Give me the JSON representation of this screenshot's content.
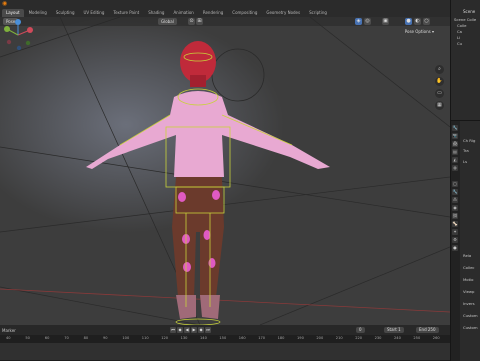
{
  "app": {
    "logo": "blender-logo"
  },
  "workspaces": [
    "Layout",
    "Modeling",
    "Sculpting",
    "UV Editing",
    "Texture Paint",
    "Shading",
    "Animation",
    "Rendering",
    "Compositing",
    "Geometry Nodes",
    "Scripting"
  ],
  "viewport": {
    "mode": "Pose",
    "transform_orientation": "Global",
    "pose_options": "Pose Options ▾",
    "gizmo_axes": {
      "x": "X",
      "y": "Y",
      "z": "Z"
    }
  },
  "timeline": {
    "label": "Marker",
    "frame_current": "0",
    "start_label": "Start",
    "start": "1",
    "end_label": "End",
    "end": "250",
    "ruler": [
      "40",
      "50",
      "60",
      "70",
      "80",
      "90",
      "100",
      "110",
      "120",
      "130",
      "140",
      "150",
      "160",
      "170",
      "180",
      "190",
      "200",
      "210",
      "220",
      "230",
      "240",
      "250",
      "260"
    ]
  },
  "outliner": {
    "title": "Scene",
    "rows": [
      "Scene Colle",
      "Colle",
      "Ca",
      "Li",
      "Cu"
    ]
  },
  "properties": {
    "rows": [
      "Ch Rig",
      "Tra",
      "Ls",
      "Rela",
      "Collec",
      "Motio",
      "Viewp",
      "Invers",
      "Custom",
      "Custom"
    ]
  },
  "colors": {
    "accent": "#4772b3",
    "bone_outline": "#c8d23a",
    "skin_pink": "#e8a9d2"
  }
}
